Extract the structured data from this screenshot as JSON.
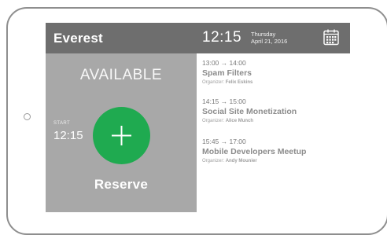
{
  "header": {
    "room_name": "Everest",
    "clock": "12:15",
    "day": "Thursday",
    "date": "April 21, 2016",
    "calendar_icon": "calendar-icon"
  },
  "status": {
    "label": "AVAILABLE",
    "start_label": "START",
    "start_time": "12:15",
    "add_icon": "plus-icon",
    "reserve_label": "Reserve"
  },
  "meetings": [
    {
      "time": "13:00 → 14:00",
      "title": "Spam Filters",
      "organizer_prefix": "Organizer:",
      "organizer": "Felix Eskins"
    },
    {
      "time": "14:15 → 15:00",
      "title": "Social Site Monetization",
      "organizer_prefix": "Organizer:",
      "organizer": "Alice Munch"
    },
    {
      "time": "15:45 → 17:00",
      "title": "Mobile Developers Meetup",
      "organizer_prefix": "Organizer:",
      "organizer": "Andy Mounier"
    }
  ],
  "colors": {
    "header_bg": "#6e6e6e",
    "status_panel_bg": "#a8a8a8",
    "accent_green": "#1faa50"
  }
}
